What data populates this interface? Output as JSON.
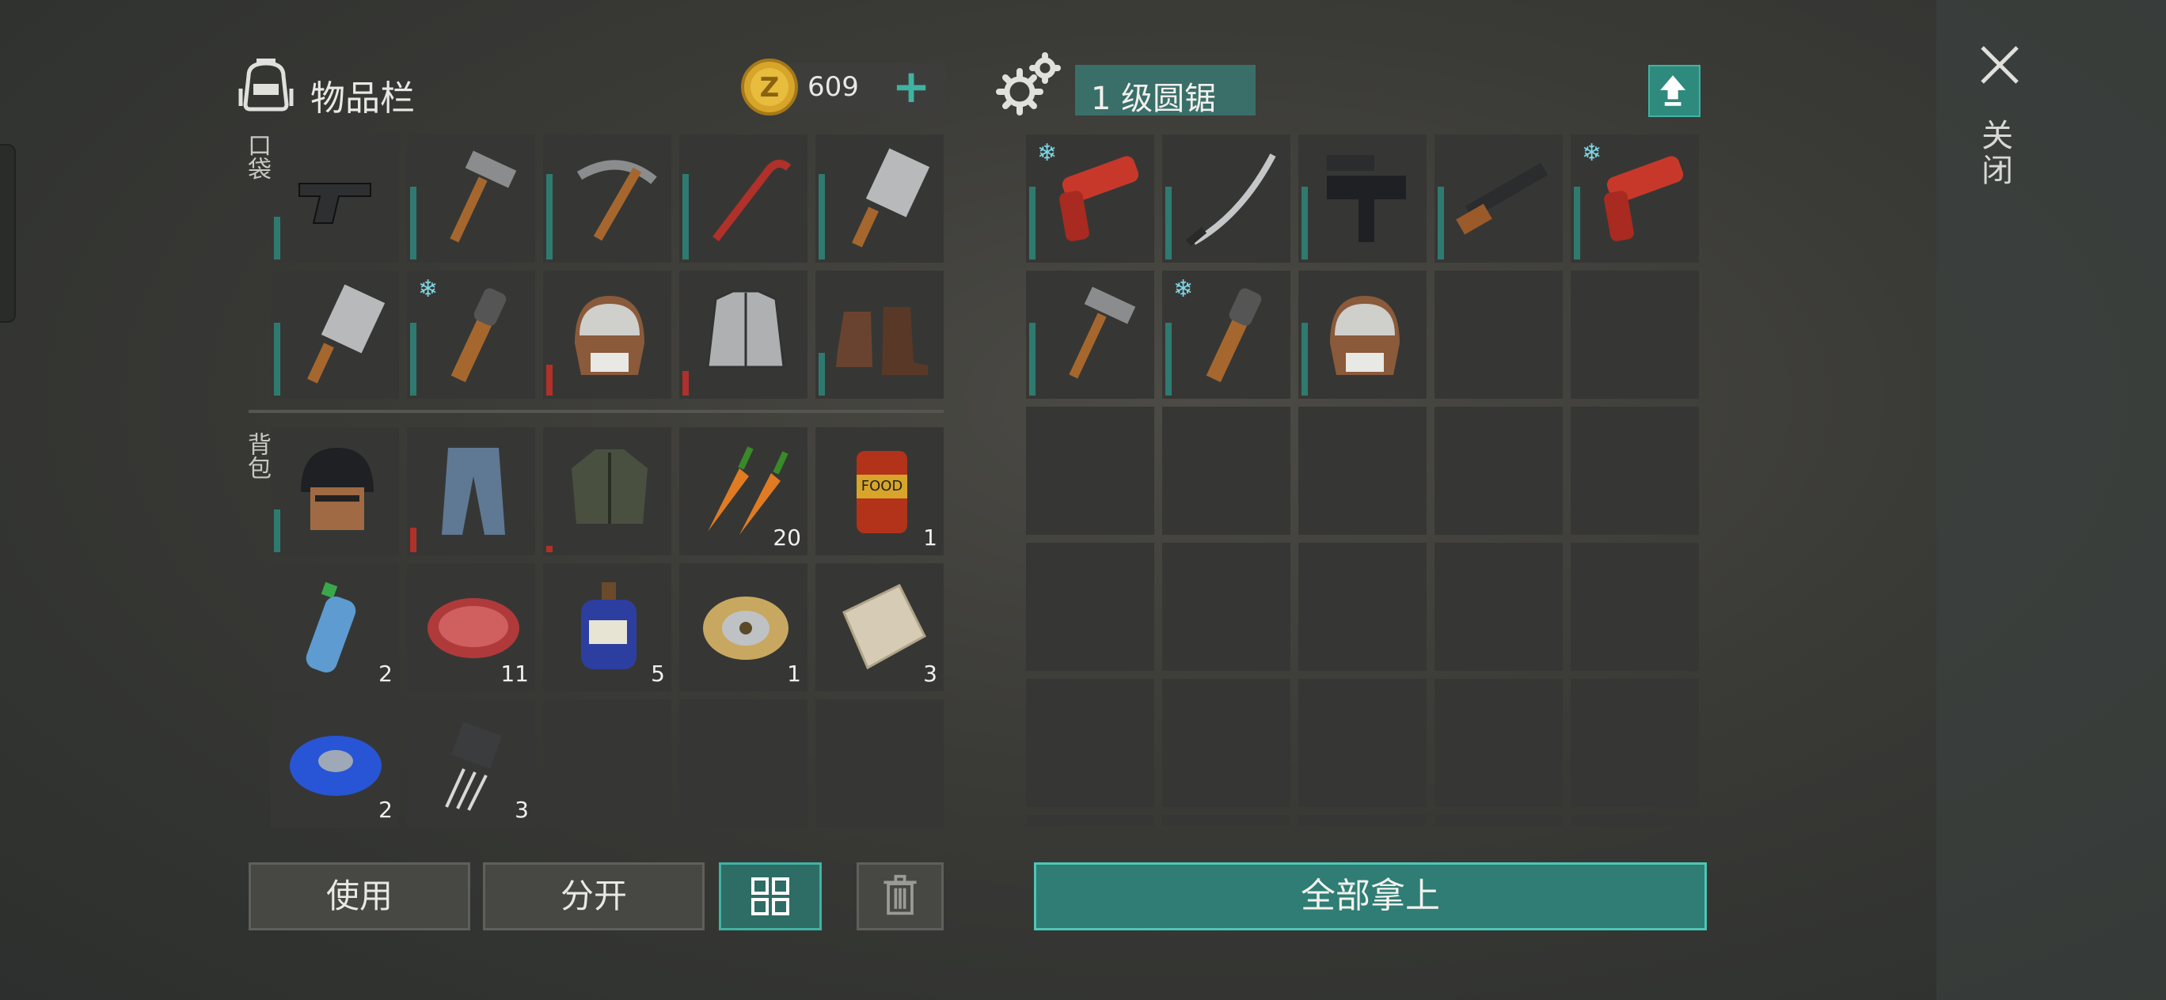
{
  "inventory": {
    "title": "物品栏",
    "coins": "609",
    "pocket_label": "口袋",
    "backpack_label": "背包"
  },
  "container": {
    "title": "1 级圆锯"
  },
  "close_label": "关闭",
  "buttons": {
    "use": "使用",
    "split": "分开",
    "take_all": "全部拿上"
  },
  "colors": {
    "accent": "#3fb3a3",
    "accent_dark": "#2f7d74",
    "durability_green": "#2f7a70",
    "durability_red": "#b0302a"
  },
  "pocket_slots": [
    {
      "icon": "pistol-icon",
      "durability": 0.35
    },
    {
      "icon": "hammer-icon",
      "durability": 0.6
    },
    {
      "icon": "pickaxe-icon",
      "durability": 0.7
    },
    {
      "icon": "crowbar-icon",
      "durability": 0.7
    },
    {
      "icon": "cleaver-icon",
      "durability": 0.7
    },
    {
      "icon": "cleaver-icon",
      "durability": 0.6
    },
    {
      "icon": "club-icon",
      "durability": 0.6,
      "frozen": true
    },
    {
      "icon": "aviator-hat-icon",
      "durability": 0.25
    },
    {
      "icon": "armor-vest-icon",
      "durability": 0.2
    },
    {
      "icon": "boots-icon",
      "durability": 0.35
    }
  ],
  "backpack_slots": [
    {
      "icon": "helmet-icon",
      "durability": 0.35
    },
    {
      "icon": "jeans-icon",
      "durability": 0.2
    },
    {
      "icon": "jacket-icon",
      "durability": 0.05
    },
    {
      "icon": "carrot-icon",
      "qty": "20"
    },
    {
      "icon": "canned-food-icon",
      "qty": "1"
    },
    {
      "icon": "water-bottle-icon",
      "qty": "2"
    },
    {
      "icon": "raw-meat-icon",
      "qty": "11"
    },
    {
      "icon": "potion-bottle-icon",
      "qty": "5"
    },
    {
      "icon": "wire-spool-icon",
      "qty": "1"
    },
    {
      "icon": "cloth-icon",
      "qty": "3"
    },
    {
      "icon": "duct-tape-icon",
      "qty": "2"
    },
    {
      "icon": "transistor-icon",
      "qty": "3"
    }
  ],
  "container_slots": [
    {
      "icon": "flare-gun-icon",
      "durability": 0.6,
      "frozen": true
    },
    {
      "icon": "katana-icon",
      "durability": 0.6
    },
    {
      "icon": "uzi-icon",
      "durability": 0.6
    },
    {
      "icon": "rifle-icon",
      "durability": 0.6
    },
    {
      "icon": "flare-gun-icon",
      "durability": 0.6,
      "frozen": true
    },
    {
      "icon": "hammer-icon",
      "durability": 0.6
    },
    {
      "icon": "club-icon",
      "durability": 0.6,
      "frozen": true
    },
    {
      "icon": "aviator-hat-icon",
      "durability": 0.6
    }
  ]
}
